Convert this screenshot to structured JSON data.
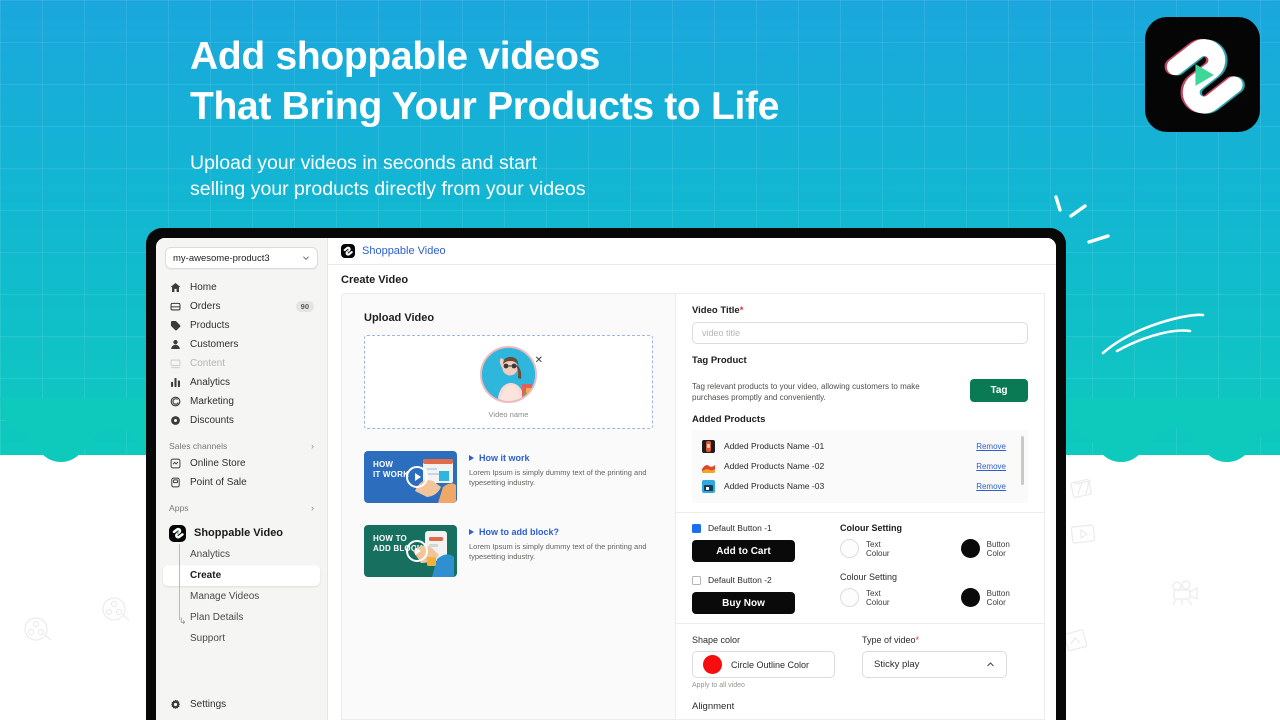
{
  "hero": {
    "line1": "Add shoppable videos",
    "line2": "That Bring Your Products to Life",
    "sub_line1": "Upload your videos in seconds and start",
    "sub_line2": "selling your products directly from your videos"
  },
  "colors": {
    "bg_top": "#1ba7dd",
    "bg_bottom": "#0ecabd",
    "accent_green": "#0a7a55",
    "link_blue": "#2c5fd0",
    "shape_red": "#f60d0d",
    "button_black": "#0a0a0a",
    "logo_green": "#3fd69a"
  },
  "sidebar": {
    "store_switcher": {
      "label": "my-awesome-product3",
      "chevron": "chevron-down-icon"
    },
    "items": [
      {
        "label": "Home",
        "icon": "home-icon",
        "badge": "",
        "muted": false
      },
      {
        "label": "Orders",
        "icon": "orders-bag-icon",
        "badge": "90",
        "muted": false
      },
      {
        "label": "Products",
        "icon": "products-tag-icon",
        "badge": "",
        "muted": false
      },
      {
        "label": "Customers",
        "icon": "customers-person-icon",
        "badge": "",
        "muted": false
      },
      {
        "label": "Content",
        "icon": "content-icon",
        "badge": "",
        "muted": true
      },
      {
        "label": "Analytics",
        "icon": "analytics-bars-icon",
        "badge": "",
        "muted": false
      },
      {
        "label": "Marketing",
        "icon": "marketing-megaphone-icon",
        "badge": "",
        "muted": false
      },
      {
        "label": "Discounts",
        "icon": "discounts-icon",
        "badge": "",
        "muted": false
      }
    ],
    "sections": [
      {
        "label": "Sales channels",
        "chevron": "chevron-right-icon"
      },
      {
        "label": "Apps",
        "chevron": "chevron-right-icon"
      }
    ],
    "sales_channels": [
      {
        "label": "Online Store",
        "icon": "online-store-icon"
      },
      {
        "label": "Point of Sale",
        "icon": "point-of-sale-icon"
      }
    ],
    "app": {
      "name": "Shoppable Video",
      "icon": "shoppable-video-logo-icon",
      "sub_items": [
        {
          "label": "Analytics",
          "active": false
        },
        {
          "label": "Create",
          "active": true
        },
        {
          "label": "Manage Videos",
          "active": false
        },
        {
          "label": "Plan Details",
          "active": false
        },
        {
          "label": "Support",
          "active": false
        }
      ]
    },
    "settings": {
      "label": "Settings",
      "icon": "gear-icon"
    }
  },
  "topbar": {
    "title": "Shoppable Video",
    "icon": "shoppable-video-logo-icon"
  },
  "page": {
    "title": "Create Video"
  },
  "upload": {
    "section_title": "Upload Video",
    "video_name": "Video name",
    "remove_icon": "close-x-icon"
  },
  "help_cards": [
    {
      "thumb_line1": "HOW",
      "thumb_line2": "IT WORK",
      "link": "How it work",
      "body": "Lorem Ipsum is simply dummy text of the printing and typesetting industry.",
      "color": "blue"
    },
    {
      "thumb_line1": "HOW TO",
      "thumb_line2": "ADD BLOCK",
      "link": "How to add block?",
      "body": "Lorem Ipsum is simply dummy text of the printing and typesetting industry.",
      "color": "green"
    }
  ],
  "form": {
    "video_title_label": "Video Title",
    "video_title_value": "",
    "video_title_placeholder": "video title",
    "tag_product_label": "Tag Product",
    "tag_product_desc": "Tag relevant products to your video, allowing customers to make purchases promptly and conveniently.",
    "tag_button": "Tag",
    "added_products_label": "Added Products",
    "added_products": [
      {
        "name": "Added Products Name -01",
        "remove": "Remove"
      },
      {
        "name": "Added Products Name -02",
        "remove": "Remove"
      },
      {
        "name": "Added Products Name -03",
        "remove": "Remove"
      }
    ],
    "buttons": [
      {
        "checkbox_label": "Default Button -1",
        "checked": true,
        "cta_label": "Add to Cart",
        "colour_setting_label": "Colour Setting",
        "text_colour_label": "Text Colour",
        "button_colour_label": "Button Color"
      },
      {
        "checkbox_label": "Default Button -2",
        "checked": false,
        "cta_label": "Buy Now",
        "colour_setting_label": "Colour Setting",
        "text_colour_label": "Text Colour",
        "button_colour_label": "Button Color"
      }
    ],
    "shape_color_label": "Shape color",
    "shape_color_value": "Circle Outline Color",
    "apply_all_note": "Apply to all video",
    "type_of_video_label": "Type of video",
    "type_of_video_value": "Sticky play",
    "alignment_label": "Alignment"
  }
}
